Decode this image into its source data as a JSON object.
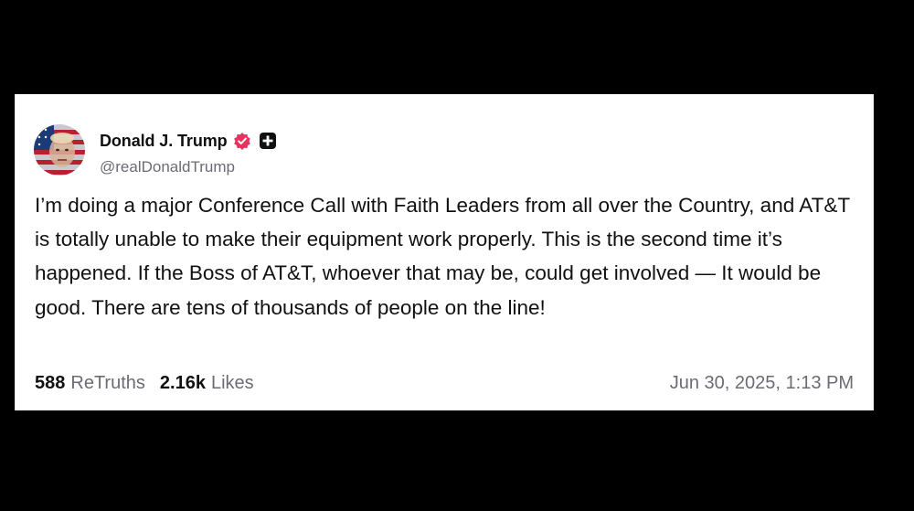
{
  "post": {
    "author": {
      "display_name": "Donald J. Trump",
      "handle": "@realDonaldTrump",
      "verified_icon": "verified-badge-icon",
      "extra_icon": "plus-icon",
      "badge_color": "#e3355f"
    },
    "text": "I’m doing a major Conference Call with Faith Leaders from all over the Country, and AT&T is totally unable to make their equipment work properly. This is the second time it’s happened. If the Boss of AT&T, whoever that may be, could get involved — It would be good. There are tens of thousands of people on the line!",
    "retruths": {
      "count": "588",
      "label": "ReTruths"
    },
    "likes": {
      "count": "2.16k",
      "label": "Likes"
    },
    "timestamp": "Jun 30, 2025, 1:13 PM"
  }
}
